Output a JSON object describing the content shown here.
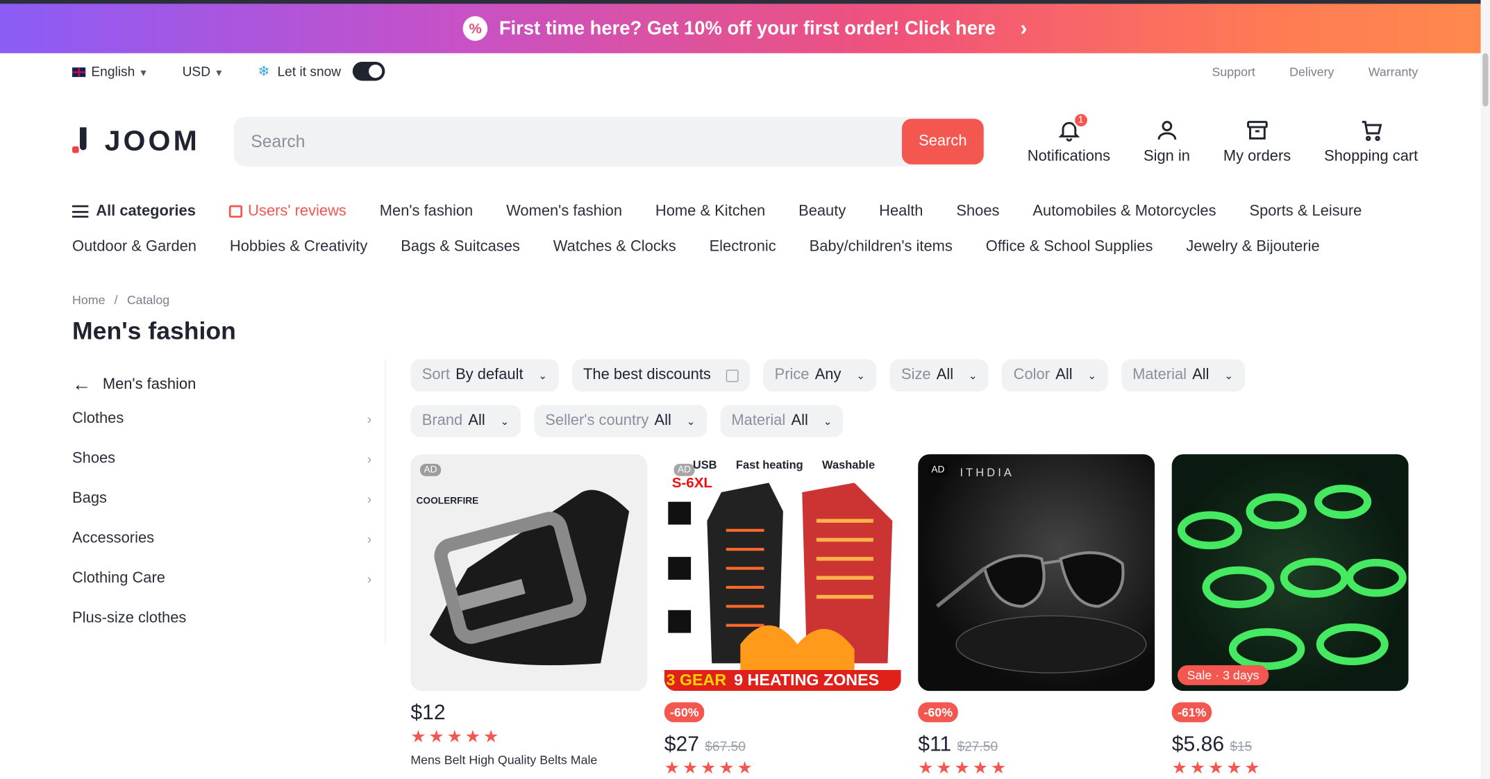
{
  "promo": {
    "text": "First time here? Get 10% off your first order! Click here",
    "icon": "percent-icon"
  },
  "util": {
    "language": "English",
    "currency": "USD",
    "snow_label": "Let it snow",
    "links": [
      "Support",
      "Delivery",
      "Warranty"
    ]
  },
  "header": {
    "logo": "JOOM",
    "search_placeholder": "Search",
    "search_button": "Search",
    "notifications": {
      "label": "Notifications",
      "count": "1"
    },
    "signin": "Sign in",
    "orders": "My orders",
    "cart": "Shopping cart"
  },
  "categories": {
    "all": "All categories",
    "reviews": "Users' reviews",
    "row1": [
      "Men's fashion",
      "Women's fashion",
      "Home & Kitchen",
      "Beauty",
      "Health",
      "Shoes",
      "Automobiles & Motorcycles",
      "Sports & Leisure"
    ],
    "row2": [
      "Outdoor & Garden",
      "Hobbies & Creativity",
      "Bags & Suitcases",
      "Watches & Clocks",
      "Electronic",
      "Baby/children's items",
      "Office & School Supplies",
      "Jewelry & Bijouterie"
    ]
  },
  "breadcrumb": {
    "home": "Home",
    "sep": "/",
    "catalog": "Catalog"
  },
  "page_title": "Men's fashion",
  "sidebar": {
    "back": "Men's fashion",
    "items": [
      "Clothes",
      "Shoes",
      "Bags",
      "Accessories",
      "Clothing Care",
      "Plus-size clothes"
    ]
  },
  "filters": {
    "sort": {
      "label": "Sort",
      "value": "By default"
    },
    "discounts": "The best discounts",
    "price": {
      "label": "Price",
      "value": "Any"
    },
    "size": {
      "label": "Size",
      "value": "All"
    },
    "color": {
      "label": "Color",
      "value": "All"
    },
    "material": {
      "label": "Material",
      "value": "All"
    },
    "brand": {
      "label": "Brand",
      "value": "All"
    },
    "seller": {
      "label": "Seller's country",
      "value": "All"
    },
    "material2": {
      "label": "Material",
      "value": "All"
    }
  },
  "products": [
    {
      "price": "$12",
      "old": "",
      "discount": "",
      "ad": "AD",
      "brand": "COOLERFIRE",
      "name": "Mens Belt High Quality Belts Male Genuine",
      "stars": "★★★★★"
    },
    {
      "price": "$27",
      "old": "$67.50",
      "discount": "-60%",
      "ad": "AD",
      "banner1": "USB",
      "banner2": "Fast heating",
      "banner3": "Washable",
      "size": "S-6XL",
      "gear": "3 GEAR",
      "zones": "9 HEATING ZONES",
      "stars": "★★★★★"
    },
    {
      "price": "$11",
      "old": "$27.50",
      "discount": "-60%",
      "ad": "AD",
      "brand": "ITHDIA",
      "stars": "★★★★★"
    },
    {
      "price": "$5.86",
      "old": "$15",
      "discount": "-61%",
      "sale": "Sale",
      "days": "3 days",
      "stars": "★★★★★"
    }
  ]
}
